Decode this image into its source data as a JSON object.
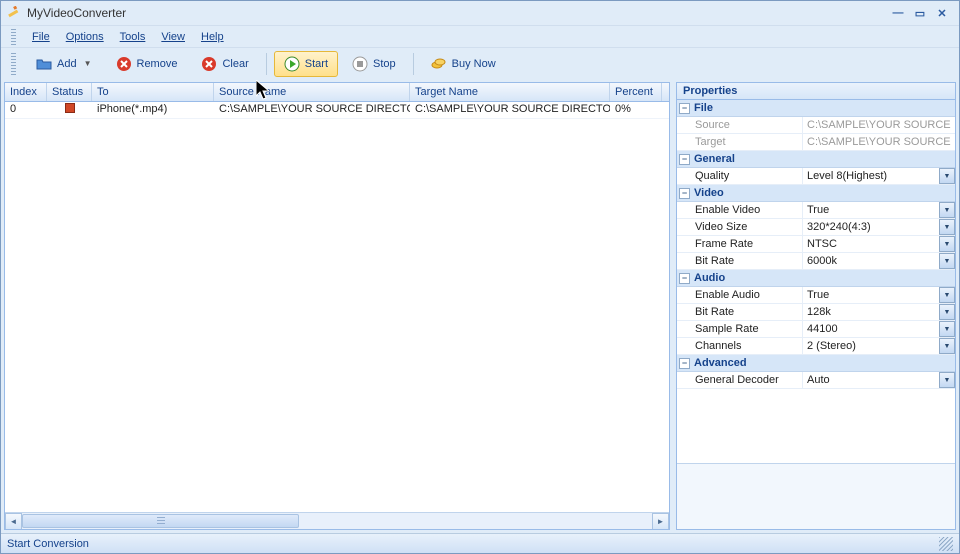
{
  "app": {
    "title": "MyVideoConverter"
  },
  "menu": {
    "file": "File",
    "options": "Options",
    "tools": "Tools",
    "view": "View",
    "help": "Help"
  },
  "toolbar": {
    "add": "Add",
    "remove": "Remove",
    "clear": "Clear",
    "start": "Start",
    "stop": "Stop",
    "buynow": "Buy Now"
  },
  "grid": {
    "headers": {
      "index": "Index",
      "status": "Status",
      "to": "To",
      "source": "Source Name",
      "target": "Target Name",
      "percent": "Percent"
    },
    "rows": [
      {
        "index": "0",
        "to": "iPhone(*.mp4)",
        "source": "C:\\SAMPLE\\YOUR SOURCE DIRECTOR...",
        "target": "C:\\SAMPLE\\YOUR SOURCE DIRECTOR...",
        "percent": "0%"
      }
    ]
  },
  "properties": {
    "title": "Properties",
    "sections": {
      "file": {
        "label": "File",
        "source_key": "Source",
        "source_val": "C:\\SAMPLE\\YOUR SOURCE",
        "target_key": "Target",
        "target_val": "C:\\SAMPLE\\YOUR SOURCE"
      },
      "general": {
        "label": "General",
        "quality_key": "Quality",
        "quality_val": "Level 8(Highest)"
      },
      "video": {
        "label": "Video",
        "enable_key": "Enable Video",
        "enable_val": "True",
        "size_key": "Video Size",
        "size_val": "320*240(4:3)",
        "frame_key": "Frame Rate",
        "frame_val": "NTSC",
        "bitrate_key": "Bit Rate",
        "bitrate_val": "6000k"
      },
      "audio": {
        "label": "Audio",
        "enable_key": "Enable Audio",
        "enable_val": "True",
        "bitrate_key": "Bit Rate",
        "bitrate_val": "128k",
        "sample_key": "Sample Rate",
        "sample_val": "44100",
        "channels_key": "Channels",
        "channels_val": "2 (Stereo)"
      },
      "advanced": {
        "label": "Advanced",
        "decoder_key": "General Decoder",
        "decoder_val": "Auto"
      }
    }
  },
  "status": {
    "text": "Start Conversion"
  }
}
